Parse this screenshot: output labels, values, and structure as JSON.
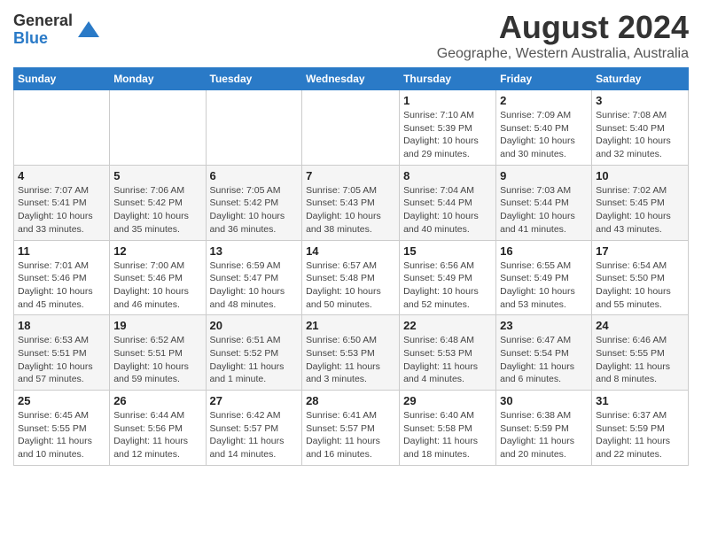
{
  "logo": {
    "general": "General",
    "blue": "Blue"
  },
  "title": "August 2024",
  "subtitle": "Geographe, Western Australia, Australia",
  "days_of_week": [
    "Sunday",
    "Monday",
    "Tuesday",
    "Wednesday",
    "Thursday",
    "Friday",
    "Saturday"
  ],
  "weeks": [
    [
      {
        "day": "",
        "info": ""
      },
      {
        "day": "",
        "info": ""
      },
      {
        "day": "",
        "info": ""
      },
      {
        "day": "",
        "info": ""
      },
      {
        "day": "1",
        "info": "Sunrise: 7:10 AM\nSunset: 5:39 PM\nDaylight: 10 hours\nand 29 minutes."
      },
      {
        "day": "2",
        "info": "Sunrise: 7:09 AM\nSunset: 5:40 PM\nDaylight: 10 hours\nand 30 minutes."
      },
      {
        "day": "3",
        "info": "Sunrise: 7:08 AM\nSunset: 5:40 PM\nDaylight: 10 hours\nand 32 minutes."
      }
    ],
    [
      {
        "day": "4",
        "info": "Sunrise: 7:07 AM\nSunset: 5:41 PM\nDaylight: 10 hours\nand 33 minutes."
      },
      {
        "day": "5",
        "info": "Sunrise: 7:06 AM\nSunset: 5:42 PM\nDaylight: 10 hours\nand 35 minutes."
      },
      {
        "day": "6",
        "info": "Sunrise: 7:05 AM\nSunset: 5:42 PM\nDaylight: 10 hours\nand 36 minutes."
      },
      {
        "day": "7",
        "info": "Sunrise: 7:05 AM\nSunset: 5:43 PM\nDaylight: 10 hours\nand 38 minutes."
      },
      {
        "day": "8",
        "info": "Sunrise: 7:04 AM\nSunset: 5:44 PM\nDaylight: 10 hours\nand 40 minutes."
      },
      {
        "day": "9",
        "info": "Sunrise: 7:03 AM\nSunset: 5:44 PM\nDaylight: 10 hours\nand 41 minutes."
      },
      {
        "day": "10",
        "info": "Sunrise: 7:02 AM\nSunset: 5:45 PM\nDaylight: 10 hours\nand 43 minutes."
      }
    ],
    [
      {
        "day": "11",
        "info": "Sunrise: 7:01 AM\nSunset: 5:46 PM\nDaylight: 10 hours\nand 45 minutes."
      },
      {
        "day": "12",
        "info": "Sunrise: 7:00 AM\nSunset: 5:46 PM\nDaylight: 10 hours\nand 46 minutes."
      },
      {
        "day": "13",
        "info": "Sunrise: 6:59 AM\nSunset: 5:47 PM\nDaylight: 10 hours\nand 48 minutes."
      },
      {
        "day": "14",
        "info": "Sunrise: 6:57 AM\nSunset: 5:48 PM\nDaylight: 10 hours\nand 50 minutes."
      },
      {
        "day": "15",
        "info": "Sunrise: 6:56 AM\nSunset: 5:49 PM\nDaylight: 10 hours\nand 52 minutes."
      },
      {
        "day": "16",
        "info": "Sunrise: 6:55 AM\nSunset: 5:49 PM\nDaylight: 10 hours\nand 53 minutes."
      },
      {
        "day": "17",
        "info": "Sunrise: 6:54 AM\nSunset: 5:50 PM\nDaylight: 10 hours\nand 55 minutes."
      }
    ],
    [
      {
        "day": "18",
        "info": "Sunrise: 6:53 AM\nSunset: 5:51 PM\nDaylight: 10 hours\nand 57 minutes."
      },
      {
        "day": "19",
        "info": "Sunrise: 6:52 AM\nSunset: 5:51 PM\nDaylight: 10 hours\nand 59 minutes."
      },
      {
        "day": "20",
        "info": "Sunrise: 6:51 AM\nSunset: 5:52 PM\nDaylight: 11 hours\nand 1 minute."
      },
      {
        "day": "21",
        "info": "Sunrise: 6:50 AM\nSunset: 5:53 PM\nDaylight: 11 hours\nand 3 minutes."
      },
      {
        "day": "22",
        "info": "Sunrise: 6:48 AM\nSunset: 5:53 PM\nDaylight: 11 hours\nand 4 minutes."
      },
      {
        "day": "23",
        "info": "Sunrise: 6:47 AM\nSunset: 5:54 PM\nDaylight: 11 hours\nand 6 minutes."
      },
      {
        "day": "24",
        "info": "Sunrise: 6:46 AM\nSunset: 5:55 PM\nDaylight: 11 hours\nand 8 minutes."
      }
    ],
    [
      {
        "day": "25",
        "info": "Sunrise: 6:45 AM\nSunset: 5:55 PM\nDaylight: 11 hours\nand 10 minutes."
      },
      {
        "day": "26",
        "info": "Sunrise: 6:44 AM\nSunset: 5:56 PM\nDaylight: 11 hours\nand 12 minutes."
      },
      {
        "day": "27",
        "info": "Sunrise: 6:42 AM\nSunset: 5:57 PM\nDaylight: 11 hours\nand 14 minutes."
      },
      {
        "day": "28",
        "info": "Sunrise: 6:41 AM\nSunset: 5:57 PM\nDaylight: 11 hours\nand 16 minutes."
      },
      {
        "day": "29",
        "info": "Sunrise: 6:40 AM\nSunset: 5:58 PM\nDaylight: 11 hours\nand 18 minutes."
      },
      {
        "day": "30",
        "info": "Sunrise: 6:38 AM\nSunset: 5:59 PM\nDaylight: 11 hours\nand 20 minutes."
      },
      {
        "day": "31",
        "info": "Sunrise: 6:37 AM\nSunset: 5:59 PM\nDaylight: 11 hours\nand 22 minutes."
      }
    ]
  ]
}
